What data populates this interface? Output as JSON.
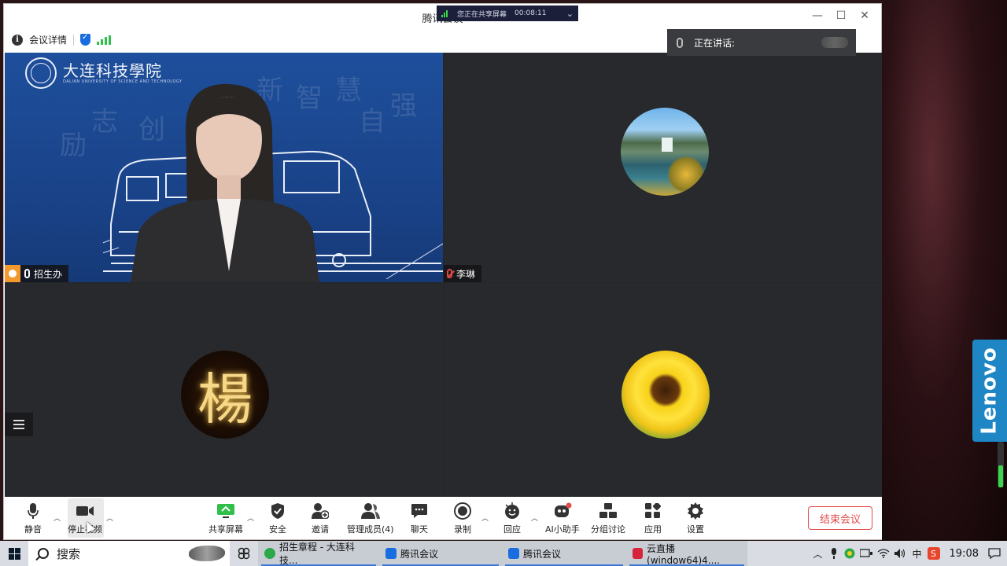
{
  "window": {
    "title": "腾讯会议"
  },
  "share_banner": {
    "text": "您正在共享屏幕",
    "timer": "00:08:11"
  },
  "infobar": {
    "meeting_details": "会议详情"
  },
  "speaking": {
    "label": "正在讲话:"
  },
  "watermark_glyphs": [
    "励",
    "志",
    "创",
    "新",
    "智",
    "慧",
    "自",
    "强"
  ],
  "participants": [
    {
      "name": "招生办",
      "host": true,
      "muted": false,
      "video": true
    },
    {
      "name": "李琳",
      "host": false,
      "muted": true,
      "video": false,
      "avatar": "waterfall"
    },
    {
      "name": "",
      "host": false,
      "muted": false,
      "video": false,
      "avatar": "yang-calligraphy",
      "avatar_glyph": "楊"
    },
    {
      "name": "",
      "host": false,
      "muted": false,
      "video": false,
      "avatar": "sunflower"
    }
  ],
  "toolbar": {
    "mute": "静音",
    "stop_video": "停止视频",
    "share_screen": "共享屏幕",
    "security": "安全",
    "invite": "邀请",
    "manage_members": "管理成员(4)",
    "chat": "聊天",
    "record": "录制",
    "reactions": "回应",
    "ai_assistant": "AI小助手",
    "breakout": "分组讨论",
    "apps": "应用",
    "settings": "设置",
    "end_meeting": "结束会议"
  },
  "taskbar": {
    "search": "搜索",
    "apps": [
      {
        "label": "招生章程 - 大连科技...",
        "color": "#2aa84a"
      },
      {
        "label": "腾讯会议",
        "color": "#1a6de0"
      },
      {
        "label": "腾讯会议",
        "color": "#1a6de0"
      },
      {
        "label": "云直播(window64)4....",
        "color": "#d6243a"
      }
    ],
    "ime": "中",
    "time": "19:08"
  },
  "desktop": {
    "brand": "Lenovo"
  },
  "colors": {
    "accent": "#1a6de0",
    "danger": "#e24b4b",
    "host_badge": "#f29a2e",
    "signal": "#2fbf4a"
  }
}
